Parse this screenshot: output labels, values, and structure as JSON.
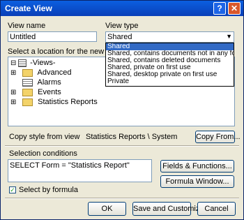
{
  "window": {
    "title": "Create View",
    "help_glyph": "?",
    "close_glyph": "✕"
  },
  "view_name": {
    "label": "View name",
    "value": "Untitled"
  },
  "view_type": {
    "label": "View type",
    "selected": "Shared",
    "options": [
      "Shared",
      "Shared, contains documents not in any folders",
      "Shared, contains deleted documents",
      "Shared, private on first use",
      "Shared, desktop private on first use",
      "Private"
    ]
  },
  "location": {
    "label": "Select a location for the new view",
    "tree": [
      {
        "expander": "⊟",
        "icon": "views-icon",
        "label": "-Views-"
      },
      {
        "expander": "⊞",
        "icon": "folder-icon",
        "label": "Advanced"
      },
      {
        "expander": "",
        "icon": "grid-icon",
        "label": "Alarms"
      },
      {
        "expander": "⊞",
        "icon": "folder-icon",
        "label": "Events"
      },
      {
        "expander": "⊞",
        "icon": "folder-icon",
        "label": "Statistics Reports"
      }
    ]
  },
  "copy_style": {
    "label": "Copy style from view",
    "value": "Statistics Reports \\ System",
    "button": "Copy From..."
  },
  "selection": {
    "label": "Selection conditions",
    "formula": "SELECT Form = \"Statistics Report\"",
    "fields_button": "Fields & Functions...",
    "formula_button": "Formula Window...",
    "checkbox_label": "Select by formula",
    "checkbox_checked": true,
    "check_mark": "✓"
  },
  "buttons": {
    "ok": "OK",
    "save_customize": "Save and Customize",
    "cancel": "Cancel"
  }
}
